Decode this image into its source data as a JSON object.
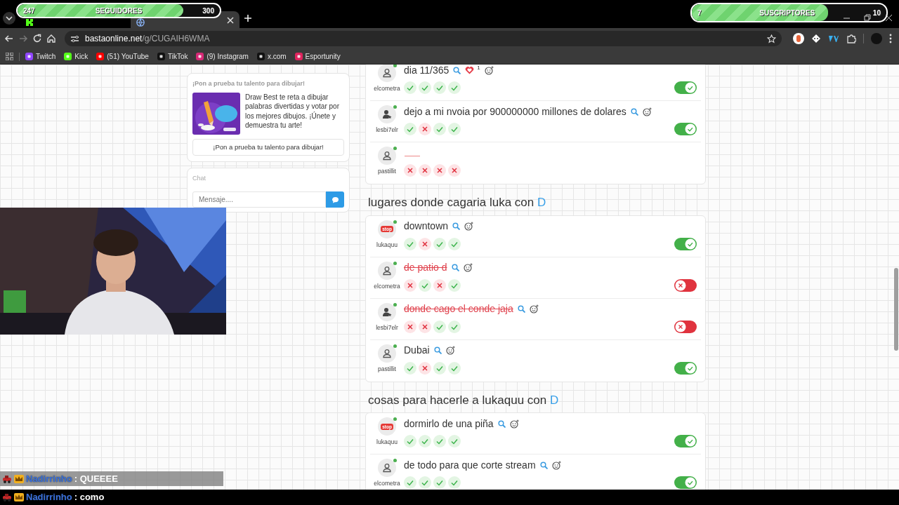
{
  "overlay_bars": [
    {
      "label": "SEGUIDORES",
      "current": "247",
      "goal": "300",
      "level": 0.82
    },
    {
      "label": "SUSCRIPTORES",
      "current": "7",
      "goal": "10",
      "level": 0.7
    }
  ],
  "browser": {
    "tabs": [
      {
        "favicon": {
          "kind": "kick"
        },
        "selected": false
      },
      {
        "favicon": {
          "kind": "globe"
        },
        "selected": true
      }
    ],
    "url_host": "bastaonline.net",
    "url_path": "/g/CUGAIH6WMA",
    "bookmarks": [
      {
        "label": "Twitch",
        "color": "#9146ff"
      },
      {
        "label": "Kick",
        "color": "#53fc18"
      },
      {
        "label": "(51) YouTube",
        "color": "#ff0000"
      },
      {
        "label": "TikTok",
        "color": "#111111"
      },
      {
        "label": "(9) Instagram",
        "color": "#d62976"
      },
      {
        "label": "x.com",
        "color": "#111111"
      },
      {
        "label": "Esportunity",
        "color": "#e0245e"
      }
    ]
  },
  "sidebar": {
    "promo": {
      "title": "¡Pon a prueba tu talento para dibujar!",
      "text": "Draw Best te reta a dibujar palabras divertidas y votar por los mejores dibujos. ¡Únete y demuestra tu arte!",
      "button": "¡Pon a prueba tu talento para dibujar!"
    },
    "chat": {
      "title": "Chat",
      "placeholder": "Mensaje...."
    }
  },
  "categories": [
    {
      "answers": [
        {
          "kind": "answer",
          "text": "dia 11/365",
          "user": "elcometra",
          "avatar": {
            "kind": "person"
          },
          "online": true,
          "likes": "1",
          "votes": [
            true,
            true,
            true,
            true
          ],
          "valid": true
        },
        {
          "kind": "answer",
          "text": "dejo a mi nvoia por 900000000 millones de dolares",
          "user": "lesbi7elr",
          "avatar": {
            "kind": "star-person"
          },
          "online": true,
          "votes": [
            true,
            false,
            true,
            true
          ],
          "valid": true
        },
        {
          "kind": "blank",
          "user": "pastillit",
          "avatar": {
            "kind": "person"
          },
          "online": true,
          "votes": [
            false,
            false,
            false,
            false
          ]
        }
      ]
    },
    {
      "title": "lugares donde cagaria luka con",
      "letter": "D",
      "answers": [
        {
          "kind": "answer",
          "text": "downtown",
          "user": "lukaquu",
          "avatar": {
            "kind": "logo",
            "text": "stop"
          },
          "online": true,
          "votes": [
            true,
            false,
            true,
            true
          ],
          "valid": true
        },
        {
          "kind": "answer",
          "text": "de patio d",
          "user": "elcometra",
          "avatar": {
            "kind": "person"
          },
          "online": true,
          "votes": [
            false,
            true,
            false,
            true
          ],
          "valid": false
        },
        {
          "kind": "answer",
          "text": "donde cago el conde jaja",
          "user": "lesbi7elr",
          "avatar": {
            "kind": "star-person"
          },
          "online": true,
          "votes": [
            false,
            false,
            true,
            true
          ],
          "valid": false
        },
        {
          "kind": "answer",
          "text": "Dubai",
          "user": "pastillit",
          "avatar": {
            "kind": "person"
          },
          "online": true,
          "votes": [
            true,
            false,
            true,
            true
          ],
          "valid": true
        }
      ]
    },
    {
      "title": "cosas para hacerle a lukaquu con",
      "letter": "D",
      "answers": [
        {
          "kind": "answer",
          "text": "dormirlo de una piña",
          "user": "lukaquu",
          "avatar": {
            "kind": "logo",
            "text": "stop"
          },
          "online": true,
          "votes": [
            true,
            true,
            true,
            true
          ],
          "valid": true
        },
        {
          "kind": "answer",
          "text": "de todo para que corte stream",
          "user": "elcometra",
          "avatar": {
            "kind": "person"
          },
          "online": true,
          "votes": [
            true,
            true,
            true,
            true
          ],
          "valid": true
        }
      ]
    }
  ],
  "stream_chat": [
    {
      "user": "Nadirrinho",
      "message": ": QUEEEE"
    },
    {
      "user": "Nadirrinho",
      "message": ": como"
    }
  ]
}
